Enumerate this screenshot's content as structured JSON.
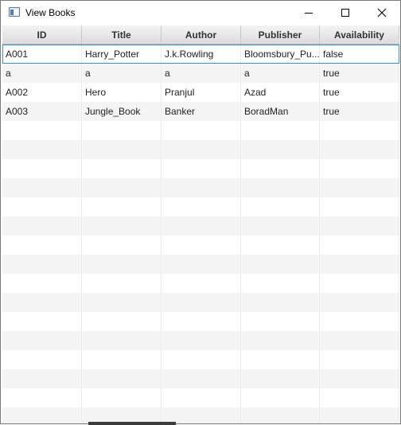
{
  "window": {
    "title": "View Books"
  },
  "table": {
    "columns": [
      "ID",
      "Title",
      "Author",
      "Publisher",
      "Availability"
    ],
    "rows": [
      [
        "A001",
        "Harry_Potter",
        "J.k.Rowling",
        "Bloomsbury_Pu...",
        "false"
      ],
      [
        "a",
        "a",
        "a",
        "a",
        "true"
      ],
      [
        "A002",
        "Hero",
        "Pranjul",
        "Azad",
        "true"
      ],
      [
        "A003",
        "Jungle_Book",
        "Banker",
        "BoradMan",
        "true"
      ]
    ],
    "selected_row": 0
  }
}
